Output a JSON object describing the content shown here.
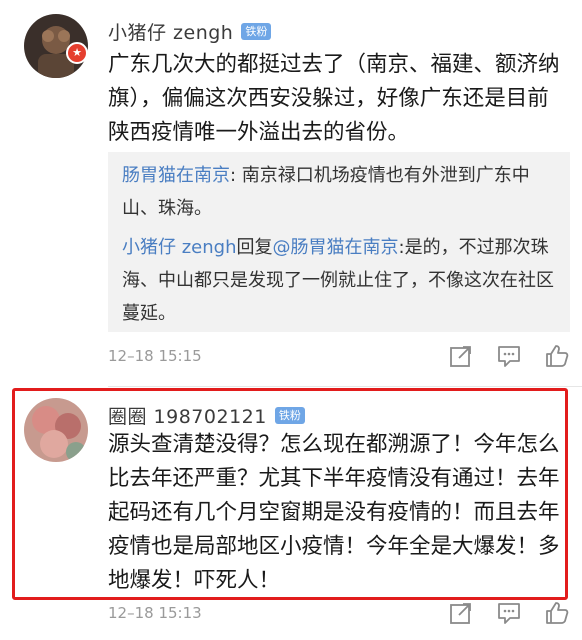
{
  "comments": [
    {
      "username": "小猪仔 zengh",
      "badge": "铁粉",
      "text": "广东几次大的都挺过去了（南京、福建、额济纳旗），偏偏这次西安没躲过，好像广东还是目前陕西疫情唯一外溢出去的省份。",
      "replies": [
        {
          "author": "肠胃猫在南京",
          "separator": ": ",
          "text": "南京禄口机场疫情也有外泄到广东中山、珠海。"
        },
        {
          "author": "小猪仔 zengh",
          "reply_word": "回复",
          "mention": "@肠胃猫在南京",
          "separator": ":",
          "text": "是的，不过那次珠海、中山都只是发现了一例就止住了，不像这次在社区蔓延。"
        }
      ],
      "timestamp": "12–18  15:15"
    },
    {
      "username": "圈圈 198702121",
      "badge": "铁粉",
      "text": "源头查清楚没得？怎么现在都溯源了！今年怎么比去年还严重？尤其下半年疫情没有通过！去年起码还有几个月空窗期是没有疫情的！而且去年疫情也是局部地区小疫情！今年全是大爆发！多地爆发！吓死人！",
      "timestamp": "12–18  15:13"
    }
  ],
  "colors": {
    "link": "#4a7ec2",
    "badge": "#6fa6e6",
    "highlight": "#e21c1c",
    "reply_bg": "#f2f2f2"
  },
  "icons": [
    "share-icon",
    "comment-icon",
    "like-icon"
  ]
}
